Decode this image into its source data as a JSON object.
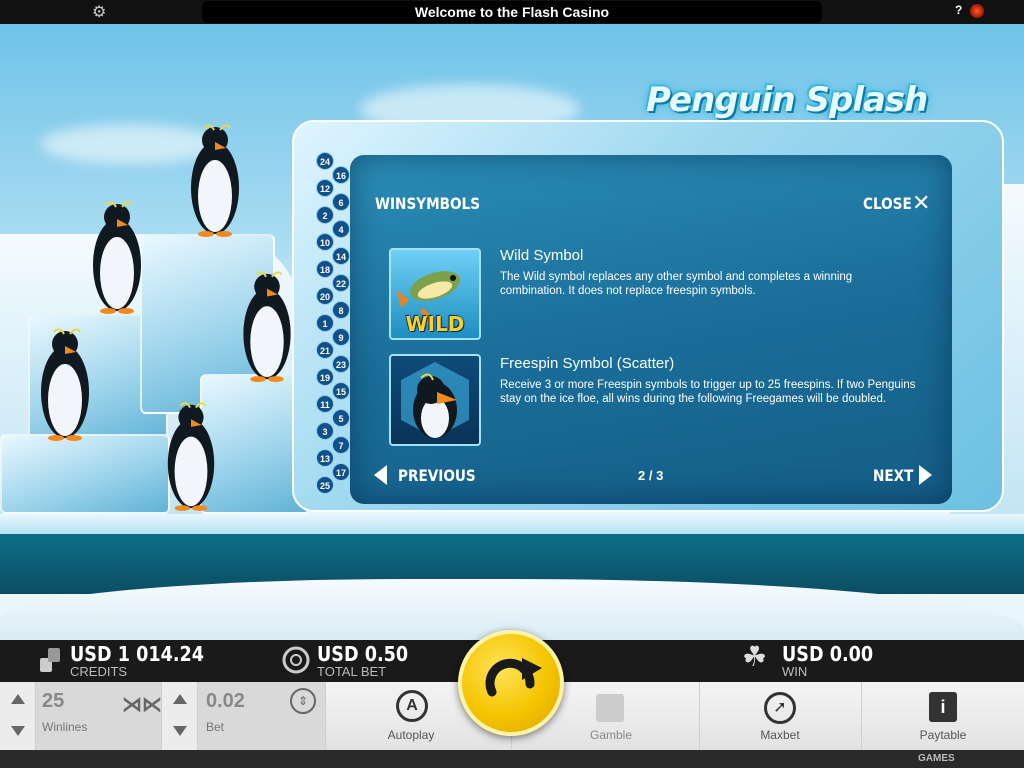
{
  "window": {
    "title": "Welcome to the Flash Casino",
    "help_label": "?"
  },
  "game": {
    "logo": "Penguin Splash"
  },
  "paytable": {
    "section_title": "WINSYMBOLS",
    "close_label": "CLOSE",
    "symbols": [
      {
        "name": "Wild Symbol",
        "badge": "WILD",
        "description": "The Wild symbol replaces any other symbol and completes a winning combination. It does not replace freespin symbols."
      },
      {
        "name": "Freespin Symbol (Scatter)",
        "badge": "",
        "description": "Receive 3 or more Freespin symbols to trigger up to 25 freespins. If two Penguins stay on the ice floe, all wins during the following Freegames will be doubled."
      }
    ],
    "prev_label": "PREVIOUS",
    "next_label": "NEXT",
    "page_indicator": "2 / 3"
  },
  "paylines": {
    "left_column": [
      "24",
      "12",
      "2",
      "10",
      "18",
      "20",
      "1",
      "21",
      "19",
      "11",
      "3",
      "13",
      "25"
    ],
    "right_column": [
      "16",
      "6",
      "4",
      "14",
      "22",
      "8",
      "9",
      "23",
      "15",
      "5",
      "7",
      "17"
    ]
  },
  "status": {
    "credits_amount": "USD 1 014.24",
    "credits_label": "CREDITS",
    "total_bet_amount": "USD 0.50",
    "total_bet_label": "TOTAL BET",
    "win_amount": "USD 0.00",
    "win_label": "WIN"
  },
  "controls": {
    "winlines_value": "25",
    "winlines_label": "Winlines",
    "bet_value": "0.02",
    "bet_label": "Bet",
    "autoplay_label": "Autoplay",
    "gamble_label": "Gamble",
    "maxbet_label": "Maxbet",
    "paytable_label": "Paytable"
  },
  "footer": {
    "brand": "GAMES"
  },
  "colors": {
    "accent_yellow": "#f5c400",
    "panel_blue": "#1a6e9a",
    "bar_dark": "#1a1a1a"
  }
}
